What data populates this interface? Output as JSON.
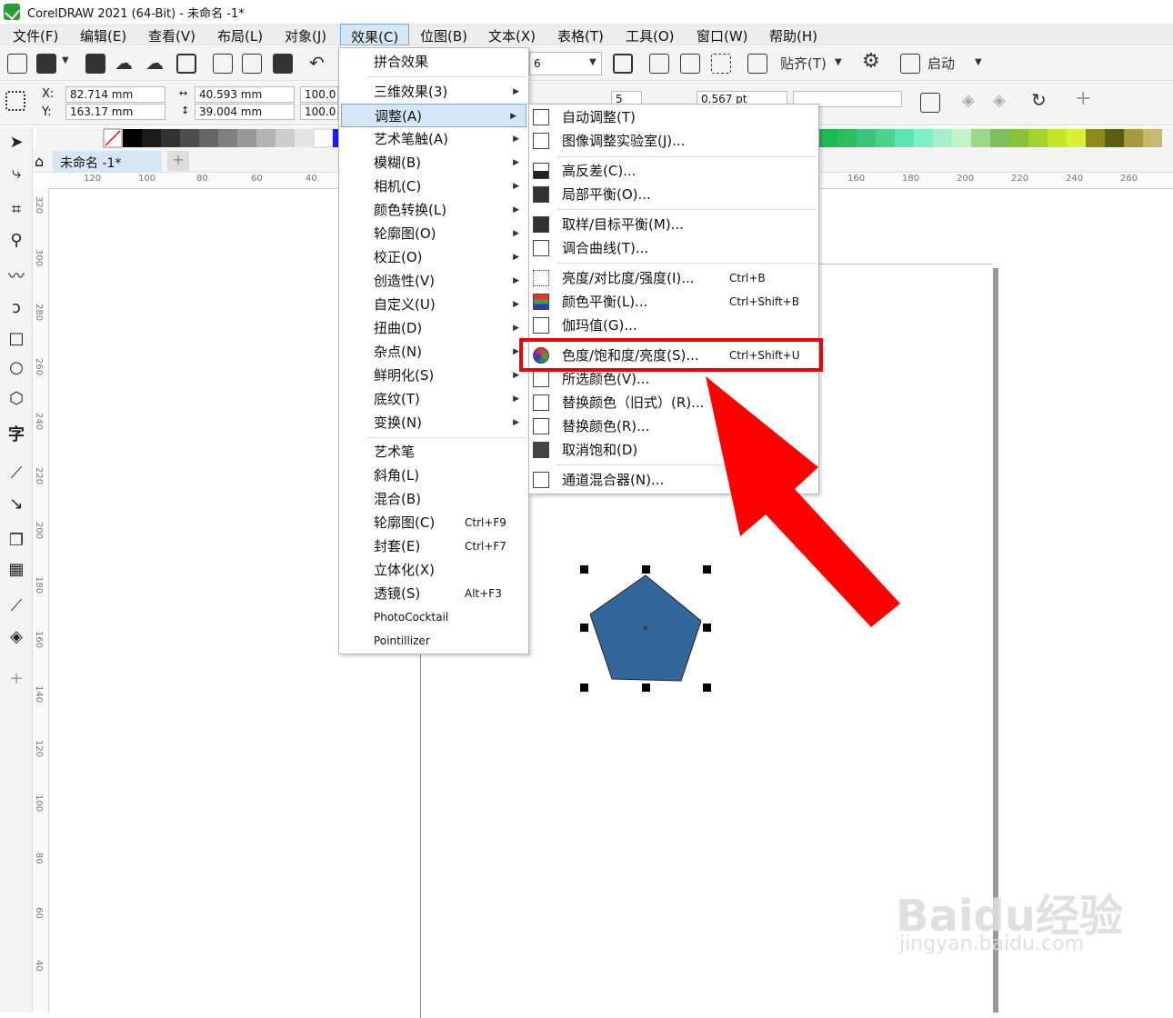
{
  "window": {
    "title": "CorelDRAW 2021 (64-Bit) - 未命名 -1*"
  },
  "menubar": [
    "文件(F)",
    "编辑(E)",
    "查看(V)",
    "布局(L)",
    "对象(J)",
    "效果(C)",
    "位图(B)",
    "文本(X)",
    "表格(T)",
    "工具(O)",
    "窗口(W)",
    "帮助(H)"
  ],
  "toolbar1": {
    "snap_label": "贴齐(T)",
    "launch_label": "启动",
    "zoom_value": "6"
  },
  "toolbar2": {
    "x_label": "X:",
    "x_value": "82.714 mm",
    "y_label": "Y:",
    "y_value": "163.17 mm",
    "w_value": "40.593 mm",
    "h_value": "39.004 mm",
    "sx_value": "100.0",
    "sy_value": "100.0",
    "sides_value": "5",
    "outline_value": "0.567 pt"
  },
  "doc": {
    "tab_label": "未命名 -1*",
    "add_tab": "+"
  },
  "hruler_labels": [
    "120",
    "100",
    "80",
    "60",
    "40",
    "160",
    "180",
    "200",
    "220",
    "240",
    "260"
  ],
  "vruler_labels": [
    "320",
    "300",
    "280",
    "260",
    "240",
    "220",
    "200",
    "180",
    "160",
    "140",
    "120",
    "100",
    "80",
    "60",
    "40"
  ],
  "effects_menu": [
    {
      "label": "拼合效果"
    },
    {
      "label": "三维效果(3)",
      "sub": true
    },
    {
      "label": "调整(A)",
      "sub": true,
      "highlight": true
    },
    {
      "label": "艺术笔触(A)",
      "sub": true
    },
    {
      "label": "模糊(B)",
      "sub": true
    },
    {
      "label": "相机(C)",
      "sub": true
    },
    {
      "label": "颜色转换(L)",
      "sub": true
    },
    {
      "label": "轮廓图(O)",
      "sub": true
    },
    {
      "label": "校正(O)",
      "sub": true
    },
    {
      "label": "创造性(V)",
      "sub": true
    },
    {
      "label": "自定义(U)",
      "sub": true
    },
    {
      "label": "扭曲(D)",
      "sub": true
    },
    {
      "label": "杂点(N)",
      "sub": true
    },
    {
      "label": "鲜明化(S)",
      "sub": true
    },
    {
      "label": "底纹(T)",
      "sub": true
    },
    {
      "label": "变换(N)",
      "sub": true
    },
    {
      "label": "艺术笔"
    },
    {
      "label": "斜角(L)"
    },
    {
      "label": "混合(B)"
    },
    {
      "label": "轮廓图(C)",
      "shortcut": "Ctrl+F9"
    },
    {
      "label": "封套(E)",
      "shortcut": "Ctrl+F7"
    },
    {
      "label": "立体化(X)"
    },
    {
      "label": "透镜(S)",
      "shortcut": "Alt+F3"
    },
    {
      "label": "PhotoCocktail"
    },
    {
      "label": "Pointillizer"
    }
  ],
  "adjust_menu": [
    {
      "label": "自动调整(T)"
    },
    {
      "label": "图像调整实验室(J)..."
    },
    {
      "label": "高反差(C)..."
    },
    {
      "label": "局部平衡(O)..."
    },
    {
      "label": "取样/目标平衡(M)..."
    },
    {
      "label": "调合曲线(T)..."
    },
    {
      "label": "亮度/对比度/强度(I)...",
      "shortcut": "Ctrl+B"
    },
    {
      "label": "颜色平衡(L)...",
      "shortcut": "Ctrl+Shift+B"
    },
    {
      "label": "伽玛值(G)..."
    },
    {
      "label": "色度/饱和度/亮度(S)...",
      "shortcut": "Ctrl+Shift+U"
    },
    {
      "label": "所选颜色(V)..."
    },
    {
      "label": "替换颜色（旧式）(R)..."
    },
    {
      "label": "替换颜色(R)..."
    },
    {
      "label": "取消饱和(D)"
    },
    {
      "label": "通道混合器(N)..."
    }
  ],
  "watermark": {
    "main": "Baidu经验",
    "sub": "jingyan.baidu.com"
  },
  "colors": {
    "accent": "#e8000b",
    "shape_fill": "#336699",
    "highlight": "#d6e8f7"
  }
}
